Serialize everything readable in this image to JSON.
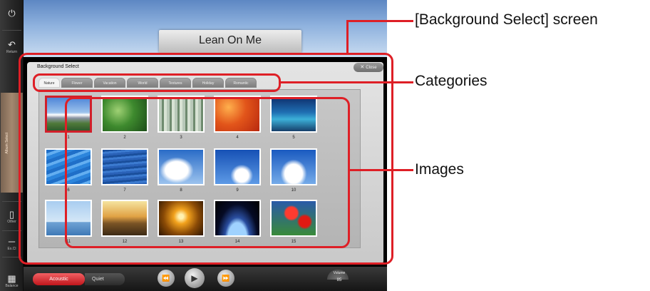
{
  "sidebar": {
    "power_icon": "power-icon",
    "return_label": "Return",
    "album_select_label": "Album Select",
    "other_label": "Other",
    "ex_label": "Ex.Cl",
    "balance_label": "Balance"
  },
  "song": {
    "title": "Lean On Me"
  },
  "dialog": {
    "title": "Background Select",
    "close_label": "Close",
    "tabs": [
      "Nature",
      "Flower",
      "Vacation",
      "World",
      "Textures",
      "Holiday",
      "Romantic"
    ],
    "active_tab": "Nature",
    "images": [
      {
        "number": "1",
        "scene": "mountain",
        "selected": true
      },
      {
        "number": "2",
        "scene": "leaves"
      },
      {
        "number": "3",
        "scene": "forest"
      },
      {
        "number": "4",
        "scene": "autumn-leaves"
      },
      {
        "number": "5",
        "scene": "coral-sea"
      },
      {
        "number": "6",
        "scene": "water-ripples"
      },
      {
        "number": "7",
        "scene": "ocean-surface"
      },
      {
        "number": "8",
        "scene": "clouds"
      },
      {
        "number": "9",
        "scene": "blue-sky"
      },
      {
        "number": "10",
        "scene": "sky-clouds"
      },
      {
        "number": "11",
        "scene": "birds-over-sea"
      },
      {
        "number": "12",
        "scene": "sunset-boat"
      },
      {
        "number": "13",
        "scene": "sunset-water"
      },
      {
        "number": "14",
        "scene": "earth-horizon"
      },
      {
        "number": "15",
        "scene": "red-flowers"
      }
    ]
  },
  "player": {
    "acoustic_label": "Acoustic",
    "quiet_label": "Quiet",
    "volume_label": "Volume",
    "volume_value": "85"
  },
  "callouts": {
    "screen": "[Background Select] screen",
    "categories": "Categories",
    "images": "Images"
  },
  "colors": {
    "highlight": "#de1f26",
    "selected_border": "#d11f2a"
  }
}
